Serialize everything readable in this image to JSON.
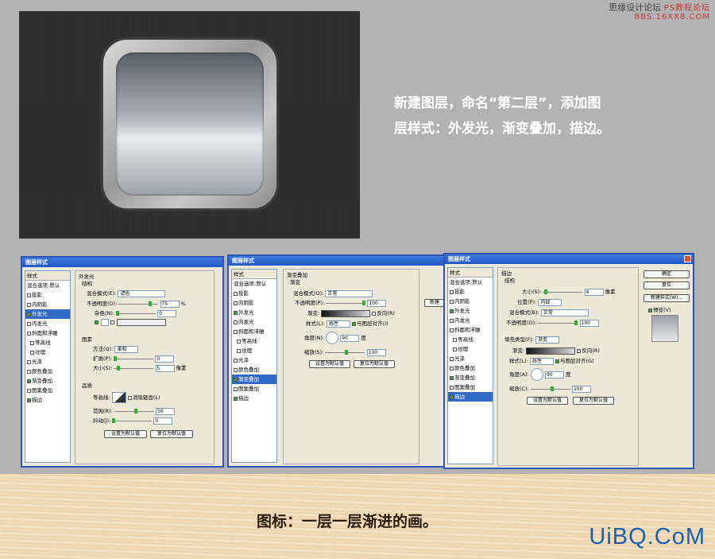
{
  "watermark": {
    "line1": "思缘设计论坛",
    "line2": "PS教程论坛",
    "line3": "BBS.16XX8.COM"
  },
  "description": {
    "line1": "新建图层，命名“第二层”，添加图",
    "line2": "层样式：外发光，渐变叠加，描边。"
  },
  "caption": "图标：一层一层渐进的画。",
  "logo": "UiBQ.CoM",
  "dialog_title": "图层样式",
  "sidebar": {
    "header": "样式",
    "items": [
      "混合选项:默认",
      "投影",
      "内阴影",
      "外发光",
      "内发光",
      "斜面和浮雕",
      "等高线",
      "纹理",
      "光泽",
      "颜色叠加",
      "渐变叠加",
      "图案叠加",
      "描边"
    ]
  },
  "dlg1": {
    "section": "外发光",
    "struct": "结构",
    "blend_label": "混合模式(E):",
    "blend": "滤色",
    "opacity_label": "不透明度(O):",
    "opacity": "75",
    "noise_label": "杂色(N):",
    "noise": "0",
    "pixel_sec": "图素",
    "method_label": "方法(Q):",
    "method": "柔和",
    "spread_label": "扩展(P):",
    "spread": "0",
    "size_label": "大小(S):",
    "size": "5",
    "px": "像素",
    "quality": "品质",
    "contour": "等高线:",
    "aa": "消除锯齿(L)",
    "range_label": "范围(R):",
    "range": "50",
    "jitter_label": "抖动(J):",
    "jitter": "0",
    "def_btn": "设置为默认值",
    "reset_btn": "复位为默认值",
    "pct": "%"
  },
  "dlg2": {
    "section": "渐变叠加",
    "sub": "渐变",
    "blend_label": "混合模式(O):",
    "blend": "正常",
    "opacity_label": "不透明度(P):",
    "opacity": "100",
    "grad_label": "渐变:",
    "reverse": "反向(R)",
    "style_label": "样式(L):",
    "style": "线性",
    "align": "与图层对齐(I)",
    "angle_label": "角度(N):",
    "angle": "90",
    "deg": "度",
    "scale_label": "缩放(S):",
    "scale": "100",
    "def_btn": "设置为默认值",
    "reset_btn": "复位为默认值",
    "new_style": "新建"
  },
  "dlg3": {
    "section": "描边",
    "struct": "结构",
    "size_label": "大小(S):",
    "size": "4",
    "px": "像素",
    "pos_label": "位置(P):",
    "pos": "内部",
    "blend_label": "混合模式(B):",
    "blend": "正常",
    "opacity_label": "不透明度(O):",
    "opacity": "100",
    "fill_label": "填充类型(F):",
    "fill": "渐变",
    "grad_label": "渐变:",
    "reverse": "反向(R)",
    "style_label": "样式(L):",
    "style": "线性",
    "align": "与图层对齐(G)",
    "angle_label": "角度(A):",
    "angle": "90",
    "deg": "度",
    "scale_label": "缩放(C):",
    "scale": "100",
    "def_btn": "设置为默认值",
    "reset_btn": "复位为默认值",
    "ok": "确定",
    "cancel": "复位",
    "new_style": "新建样式(W)...",
    "preview": "预览(V)"
  }
}
